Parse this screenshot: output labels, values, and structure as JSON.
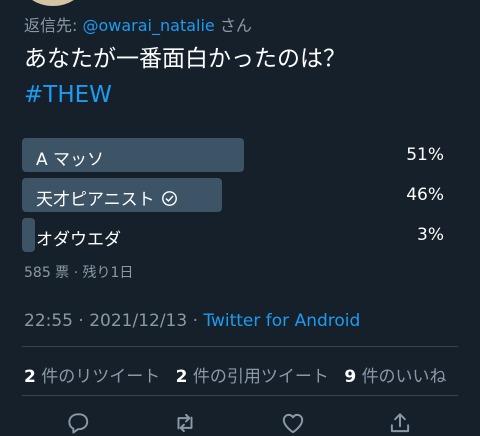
{
  "reply": {
    "prefix": "返信先: ",
    "handle": "@owarai_natalie",
    "suffix": " さん"
  },
  "tweet": {
    "text": "あなたが一番面白かったのは？",
    "hashtag": "#THEW"
  },
  "poll": {
    "options": [
      {
        "label": "A マッソ",
        "percent_text": "51%",
        "percent": 51
      },
      {
        "label": "天才ピアニスト",
        "percent_text": "46%",
        "percent": 46,
        "winner_icon": "check-circle-icon"
      },
      {
        "label": "オダウエダ",
        "percent_text": "3%",
        "percent": 3
      }
    ],
    "meta": "585 票 · 残り1日"
  },
  "timestamp": {
    "time": "22:55 · 2021/12/13 · ",
    "source": "Twitter for Android"
  },
  "stats": {
    "retweets_count": "2",
    "retweets_label": "件のリツイート",
    "quotes_count": "2",
    "quotes_label": "件の引用ツイート",
    "likes_count": "9",
    "likes_label": "件のいいね"
  },
  "actions": [
    "reply-icon",
    "retweet-icon",
    "like-icon",
    "share-icon"
  ],
  "colors": {
    "background": "#15202b",
    "accent": "#1d9bf0",
    "bar": "#3d5466",
    "muted": "#8b98a5"
  }
}
